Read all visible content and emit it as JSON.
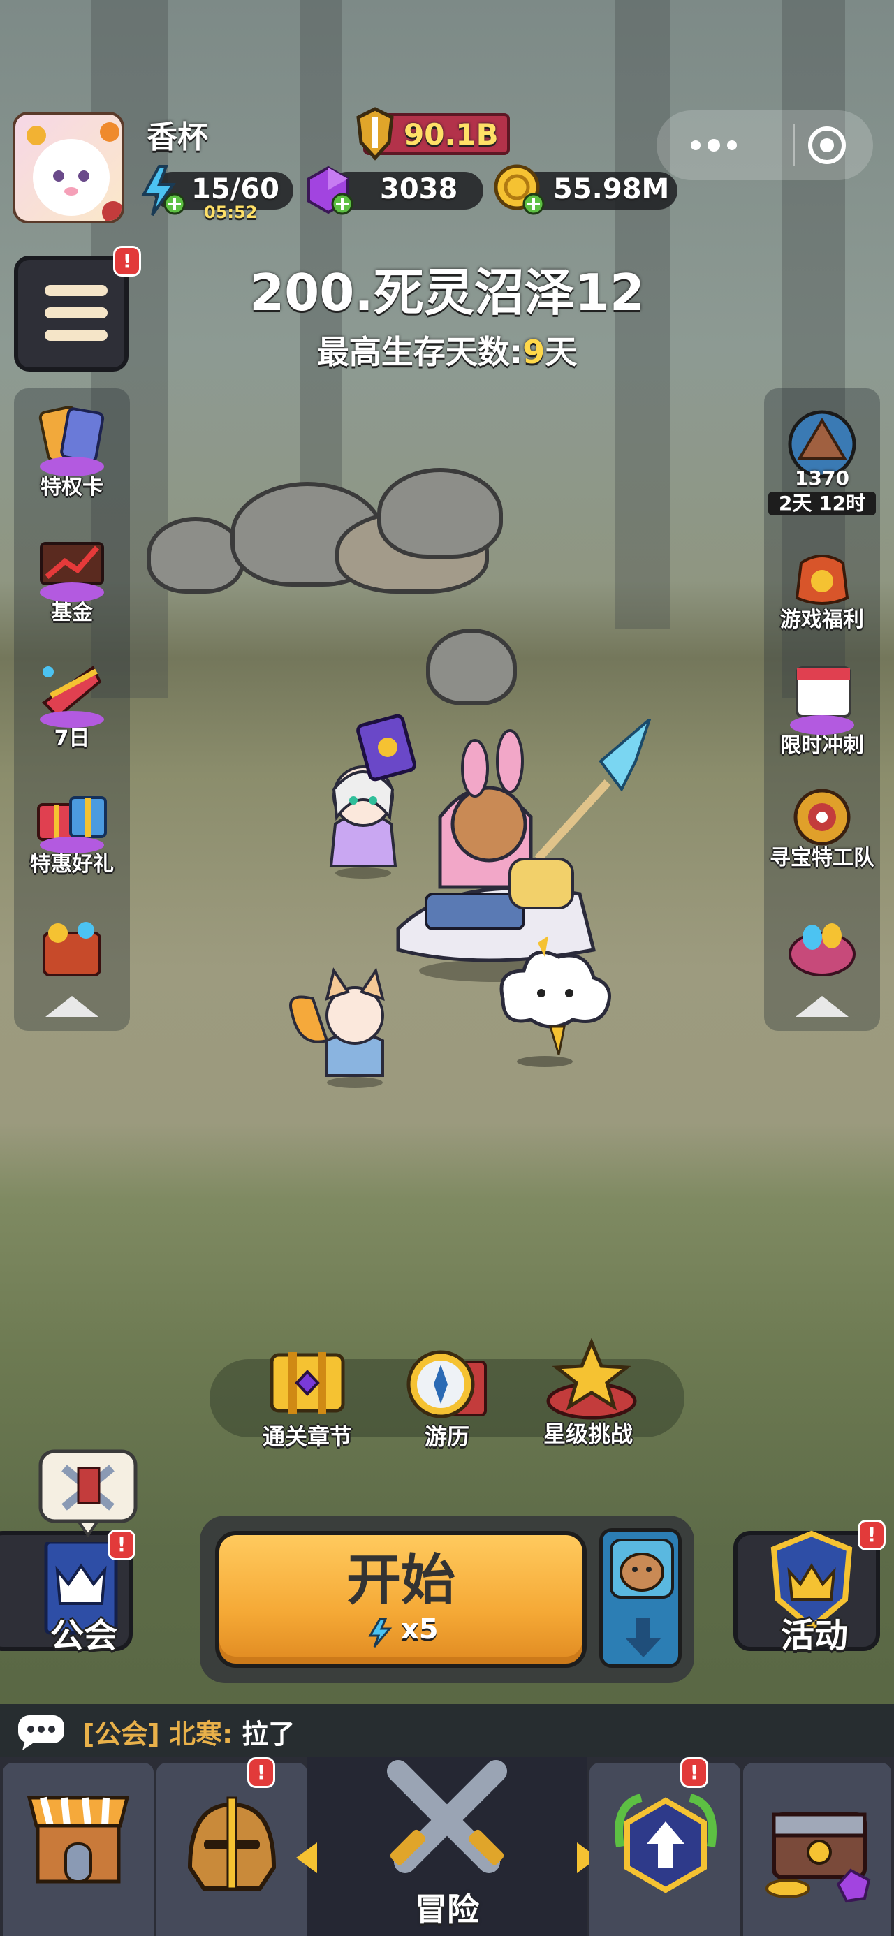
{
  "player": {
    "name": "香杯",
    "power": "90.1B"
  },
  "resources": {
    "energy": "15/60",
    "energy_timer": "05:52",
    "gems": "3038",
    "gold": "55.98M"
  },
  "stage": {
    "title": "200.死灵沼泽12",
    "subtitle_prefix": "最高生存天数:",
    "subtitle_days": "9",
    "subtitle_suffix": "天"
  },
  "left_menu": {
    "items": [
      {
        "label": "特权卡",
        "icon": "privilege-card-icon"
      },
      {
        "label": "基金",
        "icon": "fund-chest-icon"
      },
      {
        "label": "7日",
        "icon": "seven-day-gift-icon"
      },
      {
        "label": "特惠好礼",
        "icon": "special-gift-icon"
      },
      {
        "label": "",
        "icon": "treasure-pile-icon"
      }
    ]
  },
  "right_menu": {
    "event_count": "1370",
    "event_timer": "2天 12时",
    "items": [
      {
        "label": "游戏福利",
        "icon": "lucky-bag-icon"
      },
      {
        "label": "限时冲刺",
        "icon": "calendar-sprint-icon"
      },
      {
        "label": "寻宝特工队",
        "icon": "treasure-hunt-icon"
      },
      {
        "label": "",
        "icon": "egg-basket-icon"
      }
    ]
  },
  "modes": [
    {
      "label": "通关章节",
      "icon": "chapter-chest-icon"
    },
    {
      "label": "游历",
      "icon": "compass-icon"
    },
    {
      "label": "星级挑战",
      "icon": "star-challenge-icon"
    }
  ],
  "start": {
    "label": "开始",
    "cost": "x5"
  },
  "guild_label": "公会",
  "event_label": "活动",
  "chat": {
    "tag": "[公会]",
    "sender": "北寒:",
    "message": "拉了"
  },
  "bottom_nav": {
    "center_label": "冒险"
  },
  "colors": {
    "accent_orange": "#f5a936",
    "power_red": "#b3324a",
    "gold_text": "#ffd84a",
    "badge_red": "#e23a3a"
  }
}
